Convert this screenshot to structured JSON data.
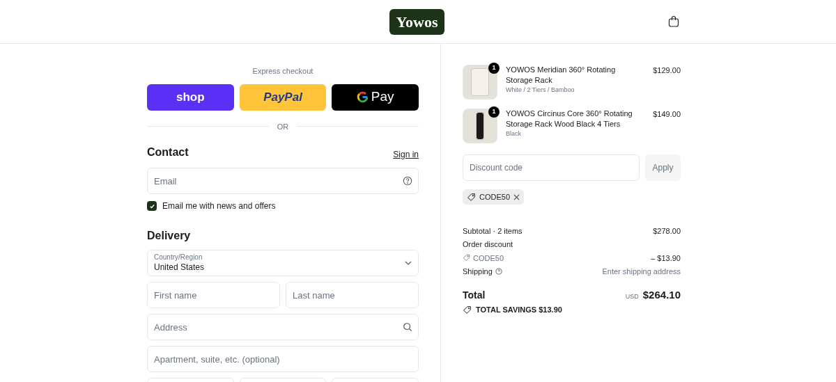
{
  "header": {
    "logo": "Yowos"
  },
  "express_checkout": {
    "title": "Express checkout",
    "buttons": [
      {
        "kind": "shop",
        "label": "shop"
      },
      {
        "kind": "paypal",
        "label": "PayPal"
      },
      {
        "kind": "gpay",
        "label": "Pay"
      }
    ],
    "divider": "OR"
  },
  "contact": {
    "title": "Contact",
    "sign_in": "Sign in",
    "email": {
      "placeholder": "Email"
    },
    "newsletter": {
      "label": "Email me with news and offers",
      "checked": true
    }
  },
  "delivery": {
    "title": "Delivery",
    "country": {
      "label": "Country/Region",
      "value": "United States"
    },
    "fields": [
      {
        "kind": "pair",
        "items": [
          {
            "placeholder": "First name"
          },
          {
            "placeholder": "Last name"
          }
        ]
      },
      {
        "kind": "search",
        "placeholder": "Address"
      },
      {
        "kind": "text",
        "placeholder": "Apartment, suite, etc. (optional)"
      }
    ]
  },
  "cart": {
    "items": [
      {
        "name": "YOWOS Meridian 360° Rotating Storage Rack",
        "variant": "White / 2 Tiers / Bamboo",
        "price": "$129.00",
        "quantity": "1",
        "kind": "white-rack"
      },
      {
        "name": "YOWOS Circinus Core 360° Rotating Storage Rack Wood Black 4 Tiers",
        "variant": "Black",
        "price": "$149.00",
        "quantity": "1",
        "kind": "black-rack"
      }
    ],
    "discount": {
      "placeholder": "Discount code",
      "button": "Apply",
      "applied_code": "CODE50"
    },
    "summary": {
      "subtotal_label": "Subtotal · 2 items",
      "subtotal": "$278.00",
      "discount_label": "Order discount",
      "discount_code": "CODE50",
      "discount_amount": "– $13.90",
      "shipping_label": "Shipping",
      "shipping_value": "Enter shipping address",
      "total_label": "Total",
      "currency": "USD",
      "total": "$264.10",
      "savings": "TOTAL SAVINGS $13.90"
    }
  }
}
